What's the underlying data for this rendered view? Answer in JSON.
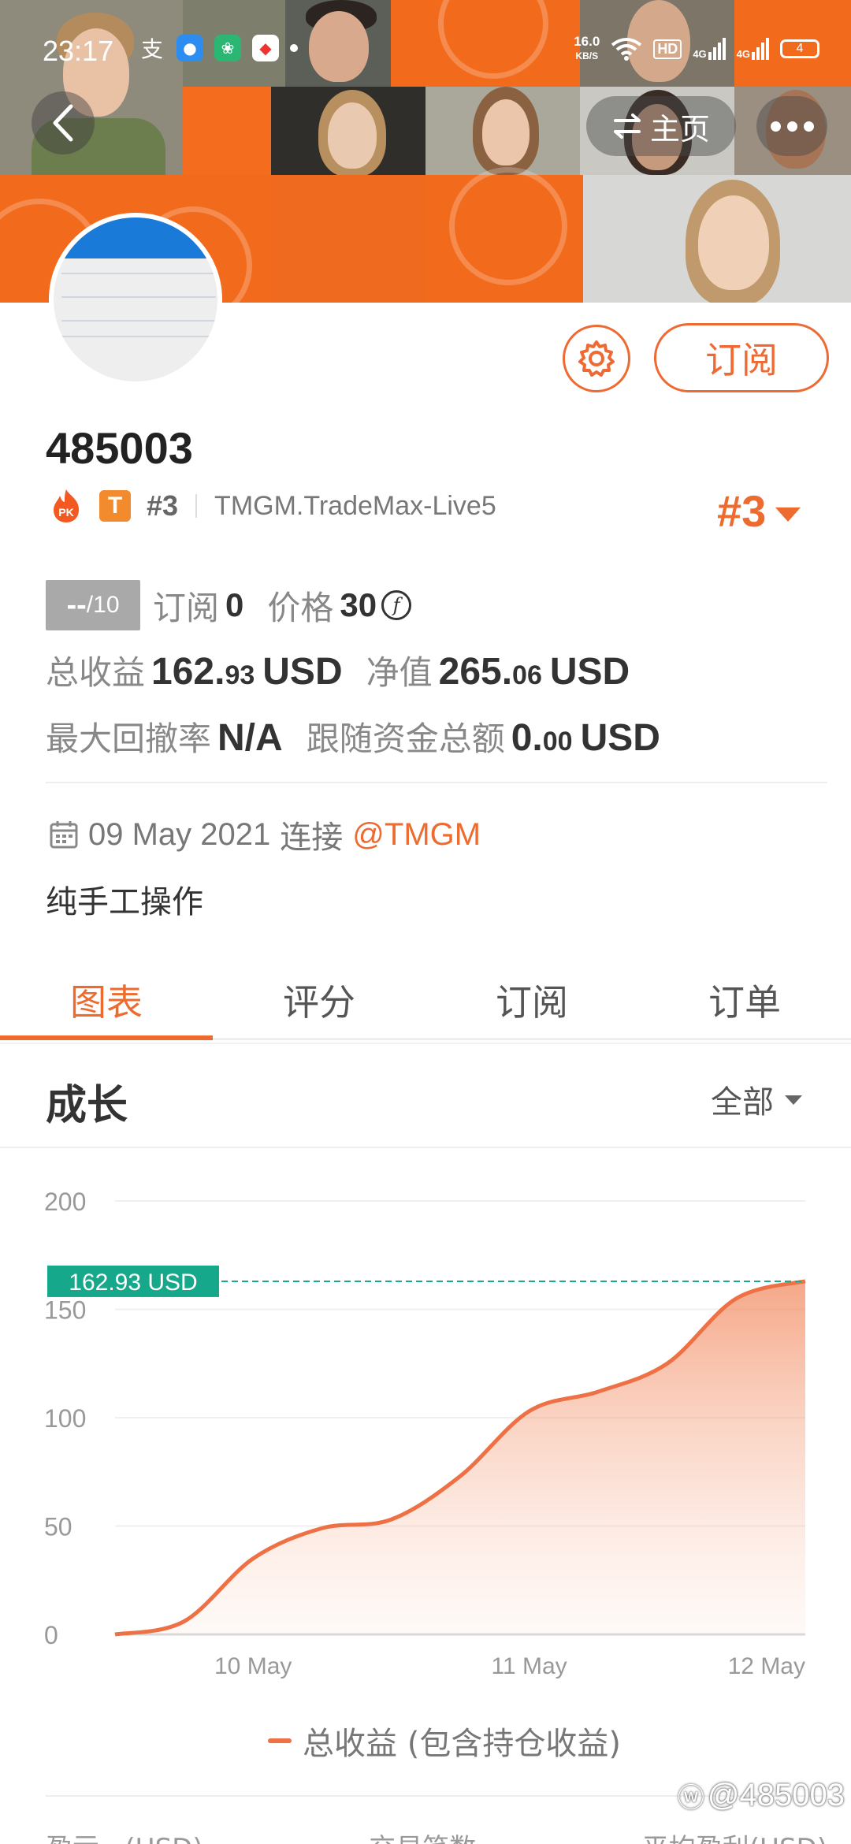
{
  "status_bar": {
    "time": "23:17",
    "net_speed_value": "16.0",
    "net_speed_unit": "KB/S",
    "hd_label": "HD",
    "net1": "4G",
    "net2": "4G",
    "battery": "4"
  },
  "nav": {
    "back_icon": "chevron-left-icon",
    "home_label": "主页",
    "more_icon": "more-dots-icon"
  },
  "profile": {
    "account_id": "485003",
    "subscribe_label": "订阅",
    "rank_small": "#3",
    "server": "TMGM.TradeMax-Live5",
    "rank_big": "#3",
    "badge_pk": "PK",
    "badge_t": "T"
  },
  "stats": {
    "score_value": "--",
    "score_max": "/10",
    "subscribers_label": "订阅",
    "subscribers_value": "0",
    "price_label": "价格",
    "price_value": "30",
    "price_currency_glyph": "f",
    "total_profit_label": "总收益",
    "total_profit_int": "162.",
    "total_profit_dec": "93",
    "total_profit_unit": "USD",
    "equity_label": "净值",
    "equity_int": "265.",
    "equity_dec": "06",
    "equity_unit": "USD",
    "max_drawdown_label": "最大回撤率",
    "max_drawdown_value": "N/A",
    "follow_funds_label": "跟随资金总额",
    "follow_funds_int": "0.",
    "follow_funds_dec": "00",
    "follow_funds_unit": "USD"
  },
  "connection": {
    "date": "09 May 2021",
    "connect_label": "连接",
    "broker": "@TMGM"
  },
  "description": "纯手工操作",
  "tabs": [
    {
      "label": "图表",
      "active": true
    },
    {
      "label": "评分",
      "active": false
    },
    {
      "label": "订阅",
      "active": false
    },
    {
      "label": "订单",
      "active": false
    }
  ],
  "section": {
    "title": "成长",
    "filter_label": "全部"
  },
  "chart_data": {
    "type": "area",
    "title": "",
    "xlabel": "",
    "ylabel": "",
    "ylim": [
      0,
      200
    ],
    "yticks": [
      0,
      50,
      100,
      150,
      200
    ],
    "xtick_labels": [
      "10 May",
      "11 May",
      "12 May"
    ],
    "current_value_label": "162.93 USD",
    "current_value": 162.93,
    "grid": true,
    "legend_position": "bottom",
    "series": [
      {
        "name": "总收益 (包含持仓收益)",
        "color": "#ee7146",
        "points": [
          {
            "x": "09 May 12:00",
            "y": 0
          },
          {
            "x": "09 May 18:00",
            "y": 6
          },
          {
            "x": "10 May 00:00",
            "y": 35
          },
          {
            "x": "10 May 06:00",
            "y": 49
          },
          {
            "x": "10 May 12:00",
            "y": 53
          },
          {
            "x": "10 May 18:00",
            "y": 73
          },
          {
            "x": "11 May 00:00",
            "y": 103
          },
          {
            "x": "11 May 06:00",
            "y": 112
          },
          {
            "x": "11 May 12:00",
            "y": 125
          },
          {
            "x": "11 May 18:00",
            "y": 155
          },
          {
            "x": "12 May 00:00",
            "y": 163
          }
        ]
      }
    ]
  },
  "bottom_labels": [
    "盈亏...(USD)",
    "交易笔数",
    "平均盈利(USD)"
  ],
  "watermark": "@485003"
}
